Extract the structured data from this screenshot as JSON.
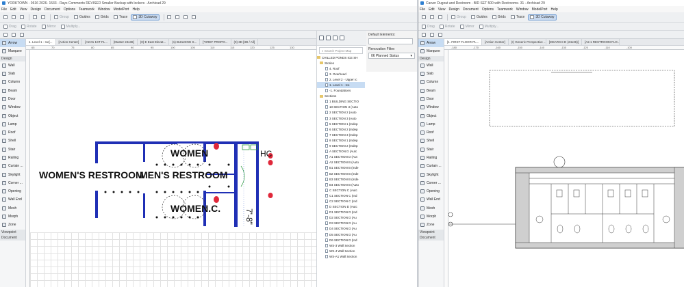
{
  "left_window": {
    "title": "YORKTOWN - 0616 2026- 1533 - Rays Comments REVISED Smaller Backup with lockers - Archicad 29",
    "menu": [
      "File",
      "Edit",
      "View",
      "Design",
      "Document",
      "Options",
      "Teamwork",
      "Window",
      "ModelPort",
      "Help"
    ],
    "toolbar": {
      "guides": "Guides",
      "grids": "Grids",
      "trace": "Trace",
      "cutaway": "3D Cutaway"
    },
    "toolbar2": {
      "group": "Group",
      "drag": "Drag",
      "rotate": "Rotate",
      "mirror": "Mirror",
      "multiply": "Multiply..."
    },
    "tabs": [
      "1. Level 1 - Ice[...",
      "[Action Center]",
      "[A2.01 1ST FL...",
      "[Master 24x36]",
      "(0) E East Elevat...",
      "(1) BUILDING S...",
      "[*XREF PROPO...",
      "(0) 3D [3D / All]"
    ],
    "ruler_ticks": [
      "65",
      "70",
      "75",
      "80",
      "85",
      "90",
      "95",
      "100",
      "105",
      "110",
      "115",
      "120",
      "125",
      "130"
    ],
    "toolbox": {
      "top": [
        "Arrow",
        "Marquee"
      ],
      "design_header": "Design",
      "design": [
        "Wall",
        "Slab",
        "Column",
        "Beam",
        "Door",
        "Window",
        "Object",
        "Lamp",
        "Roof",
        "Shell",
        "Stair",
        "Railing",
        "Curtain ...",
        "Skylight",
        "Corner ...",
        "Opening",
        "Wall End",
        "Mesh",
        "Morph",
        "Zone"
      ],
      "viewpoint": "Viewpoint",
      "document": "Document"
    },
    "drawing": {
      "label_women_big": "WOMEN'S RESTROOM",
      "label_mens_big": "MEN'S RESTROOM",
      "label_women": "WOMEN",
      "label_women_c": "WOMEN.C.",
      "label_hc": "HC",
      "dim": "7'-8\""
    },
    "navigator": {
      "search_placeholder": "Search Project Map",
      "project": "CHILLED PONDS ICE SH",
      "stories_header": "Stories",
      "stories": [
        "4. Roof",
        "3. Overhead",
        "2. Level 2 - Upper Ic",
        "1. Level 1 - Ice",
        "-1. Foundations"
      ],
      "sections_header": "Sections",
      "sections": [
        "1 BUILDING SECTIO",
        "10 SECTION 3 (Auto",
        "2 SECTION 2 (Auto",
        "3 SECTION 3 (Auto",
        "5 SECTION 1 (Indep",
        "6 SECTION 2 (Indep",
        "7 SECTION 3 (Indep",
        "8 SECTION 1 (Indep",
        "9 SECTION 2 (Indep",
        "A SECTION D (Autc",
        "A1 SECTION D (Aut",
        "A2 SECTION B (Auto",
        "B1 SECTION B (Inde",
        "B2 SECTION B (Inde",
        "B3 SECTION B (Inde",
        "B4 SECTION B (Auto",
        "C SECTION C (Autc",
        "C1 SECTION C (Ind",
        "C2 SECTION C (Ind",
        "D SECTION D (Autc",
        "D1 SECTION D (Ind",
        "D2 SECTION D (Au",
        "D3 SECTION D (Au",
        "D4 SECTION D (Au",
        "D5 SECTION D (Au",
        "D6 SECTION D (Ind",
        "WS-3 Wall Section",
        "WS-4 Wall Section",
        "WS-A1 Wall Section"
      ]
    },
    "properties": {
      "default_elements": "Default Elements:",
      "renovation_filter": "Renovation Filter:",
      "renovation_value": "06 Planned Status"
    }
  },
  "right_window": {
    "title": "Carver Dugout and Restroom - BID SET 500 with Restrooms- 31 - Archicad 29",
    "menu": [
      "File",
      "Edit",
      "View",
      "Design",
      "Document",
      "Options",
      "Teamwork",
      "Window",
      "ModelPort",
      "Help"
    ],
    "toolbar": {
      "guides": "Guides",
      "grids": "Grids",
      "trace": "Trace",
      "cutaway": "3D Cutaway"
    },
    "toolbar2": {
      "group": "Group",
      "drag": "Drag",
      "rotate": "Rotate",
      "mirror": "Mirror",
      "multiply": "Multiply..."
    },
    "tabs": [
      "[1. FIRST FLOOR PL...",
      "[Action Center]",
      "(I) Generic Perspective ...",
      "[MSARCH-D (24x36)]",
      "[A2.1 RESTROOM FLO..."
    ],
    "ruler_ticks": [
      "-180",
      "-170",
      "-160",
      "-150",
      "-140",
      "-130",
      "-120",
      "-110",
      "-100"
    ],
    "toolbox": {
      "top": [
        "Arrow",
        "Marquee"
      ],
      "design_header": "Design",
      "design": [
        "Wall",
        "Slab",
        "Column",
        "Beam",
        "Door",
        "Window",
        "Object",
        "Lamp",
        "Roof",
        "Shell",
        "Stair",
        "Railing",
        "Curtain ...",
        "Skylight",
        "Corner ...",
        "Opening",
        "Wall End",
        "Mesh",
        "Morph",
        "Zone"
      ],
      "viewpoint": "Viewpoint",
      "document": "Document"
    }
  },
  "colors": {
    "wall_blue": "#1f2fb5",
    "fixture_red": "#e0283a",
    "accent": "#2e7fd0",
    "selection": "#c7dcf3"
  }
}
